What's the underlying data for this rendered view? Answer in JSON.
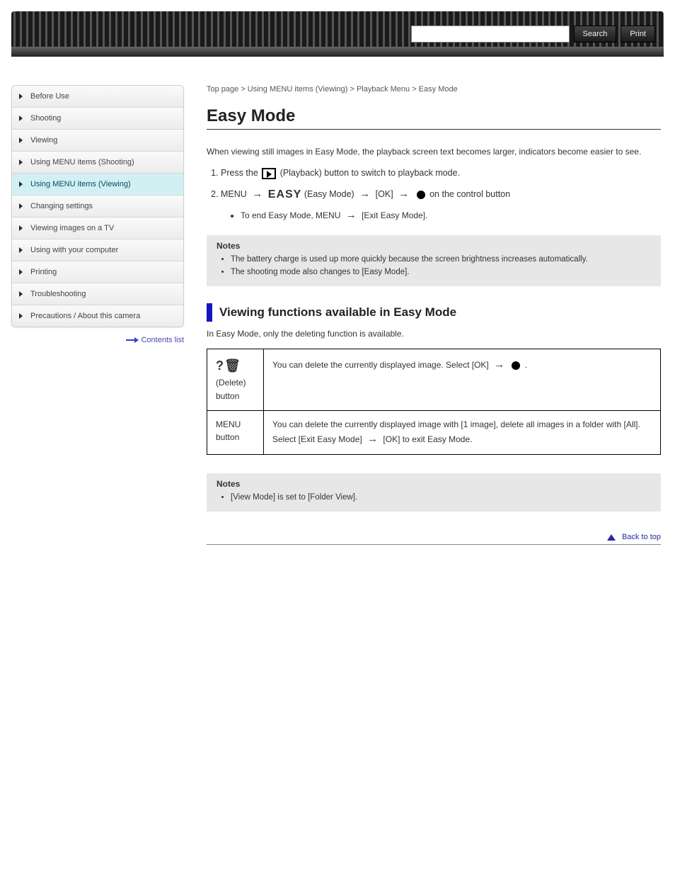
{
  "header": {
    "search_placeholder": "",
    "search_button": "Search",
    "print_button": "Print"
  },
  "sidebar": {
    "items": [
      {
        "label": "Before Use",
        "active": false
      },
      {
        "label": "Shooting",
        "active": false
      },
      {
        "label": "Viewing",
        "active": false
      },
      {
        "label": "Using MENU items (Shooting)",
        "active": false
      },
      {
        "label": "Using MENU items (Viewing)",
        "active": true
      },
      {
        "label": "Changing settings",
        "active": false
      },
      {
        "label": "Viewing images on a TV",
        "active": false
      },
      {
        "label": "Using with your computer",
        "active": false
      },
      {
        "label": "Printing",
        "active": false
      },
      {
        "label": "Troubleshooting",
        "active": false
      },
      {
        "label": "Precautions / About this camera",
        "active": false
      }
    ],
    "backlink": "Contents list"
  },
  "content": {
    "topline": "Top page > Using MENU items (Viewing) > Playback Menu > Easy Mode",
    "title": "Easy Mode",
    "intro": "When viewing still images in Easy Mode, the playback screen text becomes larger, indicators become easier to see.",
    "steps": {
      "s1_a": "Press the ",
      "s1_b": " (Playback) button to switch to playback mode.",
      "s2_a": "MENU ",
      "s2_b": " (Easy Mode) ",
      "s2_c": " [OK] ",
      "s2_d": " on the control button",
      "sub_a": "To end Easy Mode, MENU ",
      "sub_b": " [Exit Easy Mode]."
    },
    "notes1": {
      "heading": "Notes",
      "items": [
        "The battery charge is used up more quickly because the screen brightness increases automatically.",
        "The shooting mode also changes to [Easy Mode]."
      ]
    },
    "section_heading": "Viewing functions available in Easy Mode",
    "section_desc": "In Easy Mode, only the deleting function is available.",
    "table": {
      "r1c1_iconlabel": "?🗑",
      "r1c1_label": " (Delete) button",
      "r1c2": "You can delete the currently displayed image. Select [OK] ",
      "r1c2_b": ".",
      "r2c1": "MENU button",
      "r2c2_a": "You can delete the currently displayed image with [1 image], delete all images in a folder with [All].",
      "r2c2_b": "Select [Exit Easy Mode] ",
      "r2c2_c": " [OK] to exit Easy Mode."
    },
    "notes2": {
      "heading": "Notes",
      "items": [
        "[View Mode] is set to [Folder View]."
      ]
    },
    "back_to_top": "Back to top"
  }
}
